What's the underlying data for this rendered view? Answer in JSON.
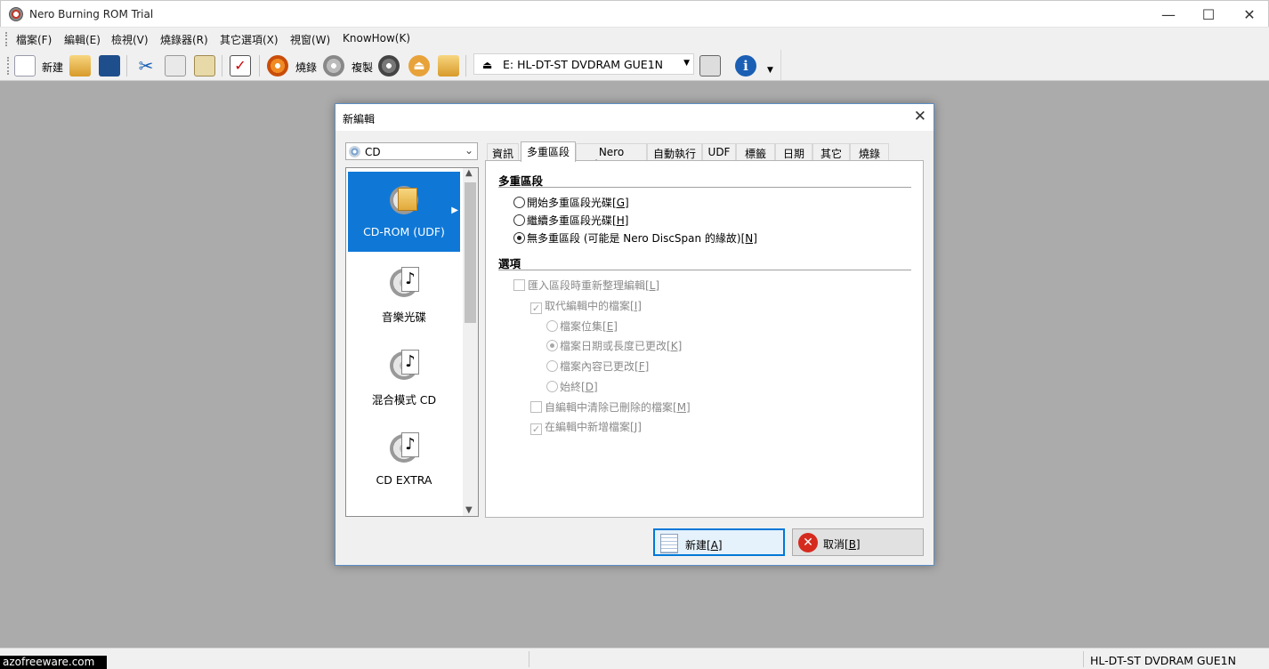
{
  "window": {
    "title": "Nero Burning ROM Trial"
  },
  "menu": [
    "檔案(F)",
    "編輯(E)",
    "檢視(V)",
    "燒錄器(R)",
    "其它選項(X)",
    "視窗(W)",
    "KnowHow(K)"
  ],
  "toolbar": {
    "new_label": "新建",
    "burn_label": "燒錄",
    "copy_label": "複製",
    "drive": "E: HL-DT-ST DVDRAM GUE1N"
  },
  "status": {
    "drive": "HL-DT-ST DVDRAM GUE1N"
  },
  "watermark": "azofreeware.com",
  "dialog": {
    "title": "新編輯",
    "media": "CD",
    "compilations": [
      "CD-ROM (UDF)",
      "音樂光碟",
      "混合模式 CD",
      "CD EXTRA"
    ],
    "tabs": [
      "資訊",
      "多重區段",
      "Nero DiscSpan",
      "自動執行",
      "UDF",
      "標籤",
      "日期",
      "其它",
      "燒錄"
    ],
    "multisession": {
      "heading": "多重區段",
      "opt_start": "開始多重區段光碟",
      "key_start": "[G]",
      "opt_continue": "繼續多重區段光碟",
      "key_continue": "[H]",
      "opt_none": "無多重區段 (可能是 Nero DiscSpan 的緣故)",
      "key_none": "[N]"
    },
    "options": {
      "heading": "選項",
      "reorg": "匯入區段時重新整理編輯",
      "key_reorg": "[L]",
      "replace": "取代編輯中的檔案",
      "key_replace": "[I]",
      "pos": "檔案位集",
      "key_pos": "[E]",
      "datesize": "檔案日期或長度已更改",
      "key_datesize": "[K]",
      "content": "檔案內容已更改",
      "key_content": "[F]",
      "always": "始終",
      "key_always": "[D]",
      "remove": "自編輯中清除已刪除的檔案",
      "key_remove": "[M]",
      "add": "在編輯中新增檔案",
      "key_add": "[J]"
    },
    "buttons": {
      "new": "新建",
      "new_key": "[A]",
      "cancel": "取消",
      "cancel_key": "[B]"
    }
  }
}
